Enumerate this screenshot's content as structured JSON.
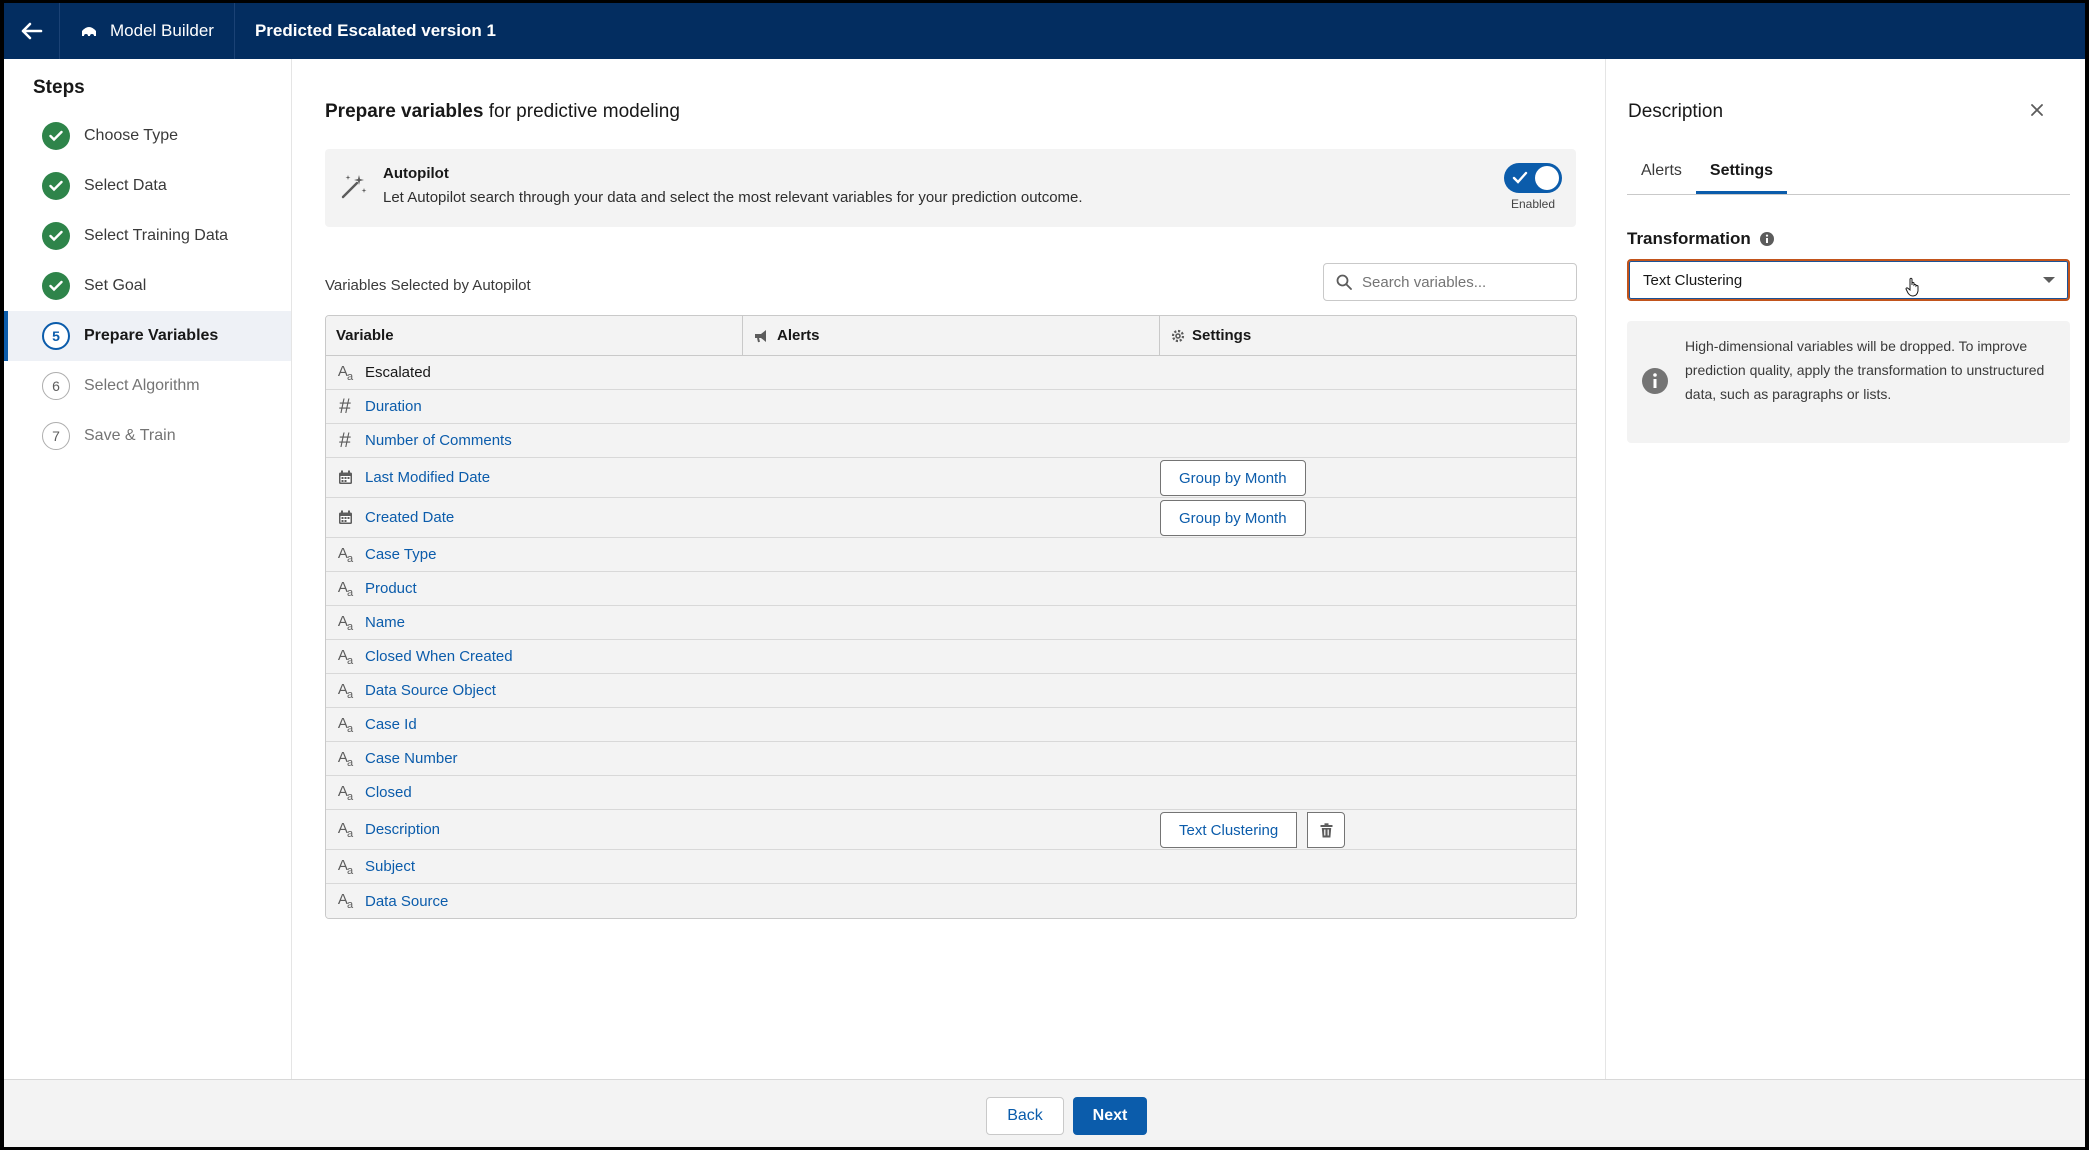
{
  "header": {
    "app_name": "Model Builder",
    "model_title": "Predicted Escalated version 1",
    "bg_color": "#032d60"
  },
  "steps": {
    "title": "Steps",
    "items": [
      {
        "number": "1",
        "label": "Choose Type",
        "state": "done"
      },
      {
        "number": "2",
        "label": "Select Data",
        "state": "done"
      },
      {
        "number": "3",
        "label": "Select Training Data",
        "state": "done"
      },
      {
        "number": "4",
        "label": "Set Goal",
        "state": "done"
      },
      {
        "number": "5",
        "label": "Prepare Variables",
        "state": "current"
      },
      {
        "number": "6",
        "label": "Select Algorithm",
        "state": "pending"
      },
      {
        "number": "7",
        "label": "Save & Train",
        "state": "pending"
      }
    ]
  },
  "main": {
    "heading_bold": "Prepare variables",
    "heading_rest": " for predictive modeling",
    "autopilot": {
      "title": "Autopilot",
      "description": "Let Autopilot search through your data and select the most relevant variables for your prediction outcome.",
      "toggle_state": "Enabled",
      "enabled": true
    },
    "variables_label": "Variables Selected by Autopilot",
    "search_placeholder": "Search variables...",
    "table": {
      "columns": [
        "Variable",
        "Alerts",
        "Settings"
      ],
      "rows": [
        {
          "type": "text",
          "name": "Escalated",
          "link": false,
          "setting": ""
        },
        {
          "type": "number",
          "name": "Duration",
          "link": true,
          "setting": ""
        },
        {
          "type": "number",
          "name": "Number of Comments",
          "link": true,
          "setting": ""
        },
        {
          "type": "date",
          "name": "Last Modified Date",
          "link": true,
          "setting": "Group by Month"
        },
        {
          "type": "date",
          "name": "Created Date",
          "link": true,
          "setting": "Group by Month"
        },
        {
          "type": "text",
          "name": "Case Type",
          "link": true,
          "setting": ""
        },
        {
          "type": "text",
          "name": "Product",
          "link": true,
          "setting": ""
        },
        {
          "type": "text",
          "name": "Name",
          "link": true,
          "setting": ""
        },
        {
          "type": "text",
          "name": "Closed When Created",
          "link": true,
          "setting": ""
        },
        {
          "type": "text",
          "name": "Data Source Object",
          "link": true,
          "setting": ""
        },
        {
          "type": "text",
          "name": "Case Id",
          "link": true,
          "setting": ""
        },
        {
          "type": "text",
          "name": "Case Number",
          "link": true,
          "setting": ""
        },
        {
          "type": "text",
          "name": "Closed",
          "link": true,
          "setting": ""
        },
        {
          "type": "text",
          "name": "Description",
          "link": true,
          "setting": "Text Clustering",
          "deletable": true
        },
        {
          "type": "text",
          "name": "Subject",
          "link": true,
          "setting": ""
        },
        {
          "type": "text",
          "name": "Data Source",
          "link": true,
          "setting": ""
        }
      ]
    }
  },
  "panel": {
    "title": "Description",
    "tabs": [
      {
        "label": "Alerts",
        "active": false
      },
      {
        "label": "Settings",
        "active": true
      }
    ],
    "transformation_label": "Transformation",
    "transformation_value": "Text Clustering",
    "note": "High-dimensional variables will be dropped. To improve prediction quality, apply the transformation to unstructured data, such as paragraphs or lists."
  },
  "footer": {
    "back_label": "Back",
    "next_label": "Next",
    "accent": "#0b5cab"
  }
}
